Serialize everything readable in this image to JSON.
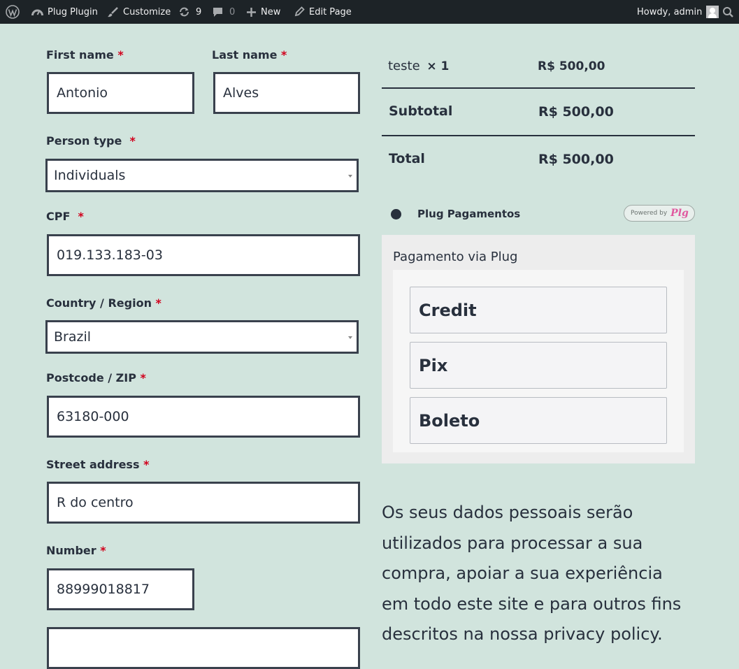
{
  "admin_bar": {
    "site_name": "Plug Plugin",
    "customize": "Customize",
    "updates_count": "9",
    "comments_count": "0",
    "new": "New",
    "edit_page": "Edit Page",
    "howdy": "Howdy, admin"
  },
  "form": {
    "required_mark": "*",
    "first_name": {
      "label": "First name",
      "value": "Antonio"
    },
    "last_name": {
      "label": "Last name",
      "value": "Alves"
    },
    "person_type": {
      "label": "Person type",
      "value": "Individuals"
    },
    "cpf": {
      "label": "CPF",
      "value": "019.133.183-03"
    },
    "country": {
      "label": "Country / Region",
      "value": "Brazil"
    },
    "postcode": {
      "label": "Postcode / ZIP",
      "value": "63180-000"
    },
    "street": {
      "label": "Street address",
      "value": "R do centro"
    },
    "number": {
      "label": "Number",
      "value": "88999018817"
    }
  },
  "order": {
    "item_name": "teste",
    "item_qty": "× 1",
    "item_price": "R$ 500,00",
    "subtotal_label": "Subtotal",
    "subtotal_value": "R$ 500,00",
    "total_label": "Total",
    "total_value": "R$ 500,00"
  },
  "payment": {
    "method_label": "Plug Pagamentos",
    "powered_by": "Powered by",
    "powered_logo": "Plg",
    "box_title": "Pagamento via Plug",
    "options": [
      "Credit",
      "Pix",
      "Boleto"
    ]
  },
  "privacy_text": "Os seus dados pessoais serão utilizados para processar a sua compra, apoiar a sua experiência em todo este site e para outros fins descritos na nossa privacy policy."
}
